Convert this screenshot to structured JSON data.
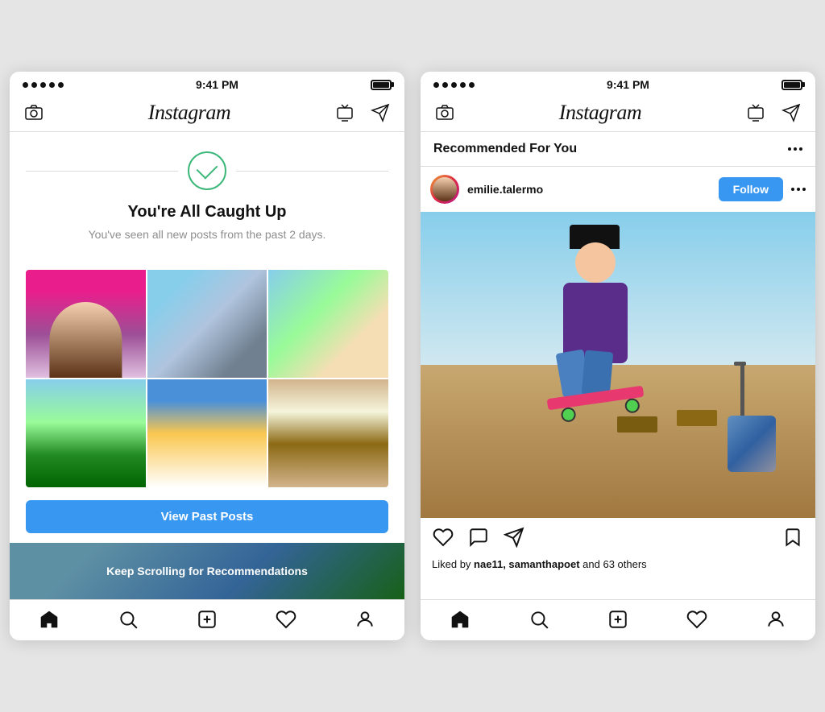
{
  "phone1": {
    "status": {
      "time": "9:41 PM"
    },
    "nav": {
      "logo": "Instagram"
    },
    "caught_up": {
      "title": "You're All Caught Up",
      "subtitle": "You've seen all new posts from the past 2 days."
    },
    "view_past_btn": "View Past Posts",
    "keep_scrolling": "Keep Scrolling for Recommendations"
  },
  "phone2": {
    "status": {
      "time": "9:41 PM"
    },
    "nav": {
      "logo": "Instagram"
    },
    "recommendation": {
      "title": "Recommended For You"
    },
    "post": {
      "username": "emilie.talermo",
      "follow_btn": "Follow",
      "likes_text": "Liked by ",
      "likes_users": "nae11, samanthapoet",
      "likes_others": " and 63 others"
    }
  }
}
